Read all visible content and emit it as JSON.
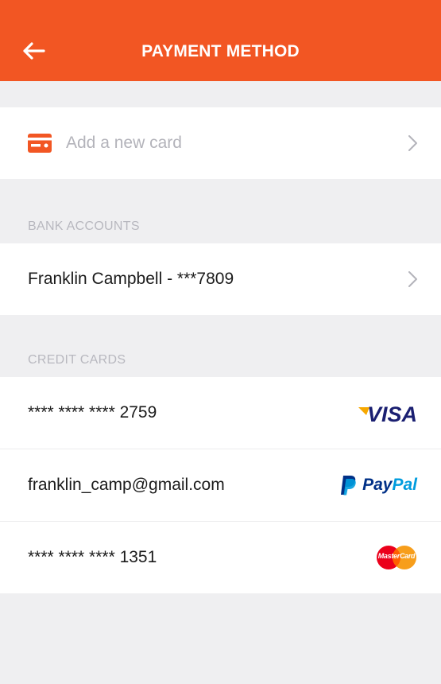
{
  "header": {
    "title": "PAYMENT METHOD",
    "back_icon": "arrow-left-icon"
  },
  "add_card": {
    "label": "Add a new card",
    "icon": "credit-card-icon"
  },
  "bank_accounts": {
    "section_label": "BANK ACCOUNTS",
    "items": [
      {
        "label": "Franklin Campbell - ***7809"
      }
    ]
  },
  "credit_cards": {
    "section_label": "CREDIT CARDS",
    "items": [
      {
        "label": "**** **** **** 2759",
        "brand": "VISA"
      },
      {
        "label": "franklin_camp@gmail.com",
        "brand_pay": "Pay",
        "brand_pal": "Pal"
      },
      {
        "label": "**** **** **** 1351",
        "brand": "MasterCard"
      }
    ]
  },
  "colors": {
    "accent": "#f25623",
    "visa_blue": "#1a1f71",
    "paypal_dark": "#003087",
    "paypal_light": "#009cde"
  }
}
